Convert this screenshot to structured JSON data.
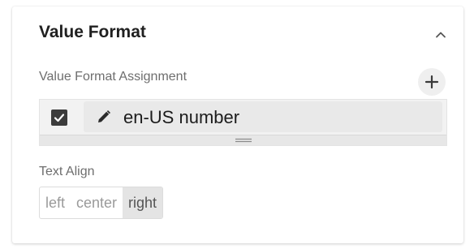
{
  "section": {
    "title": "Value Format"
  },
  "value_format_assignment": {
    "label": "Value Format Assignment",
    "items": [
      {
        "label": "en-US number",
        "checked": true
      }
    ]
  },
  "text_align": {
    "label": "Text Align",
    "options": [
      "left",
      "center",
      "right"
    ],
    "selected": "right"
  },
  "icons": {
    "collapse": "chevron-up-icon",
    "add": "plus-icon",
    "check": "checkmark-icon",
    "edit": "pencil-icon",
    "resize": "drag-handle-icon"
  }
}
